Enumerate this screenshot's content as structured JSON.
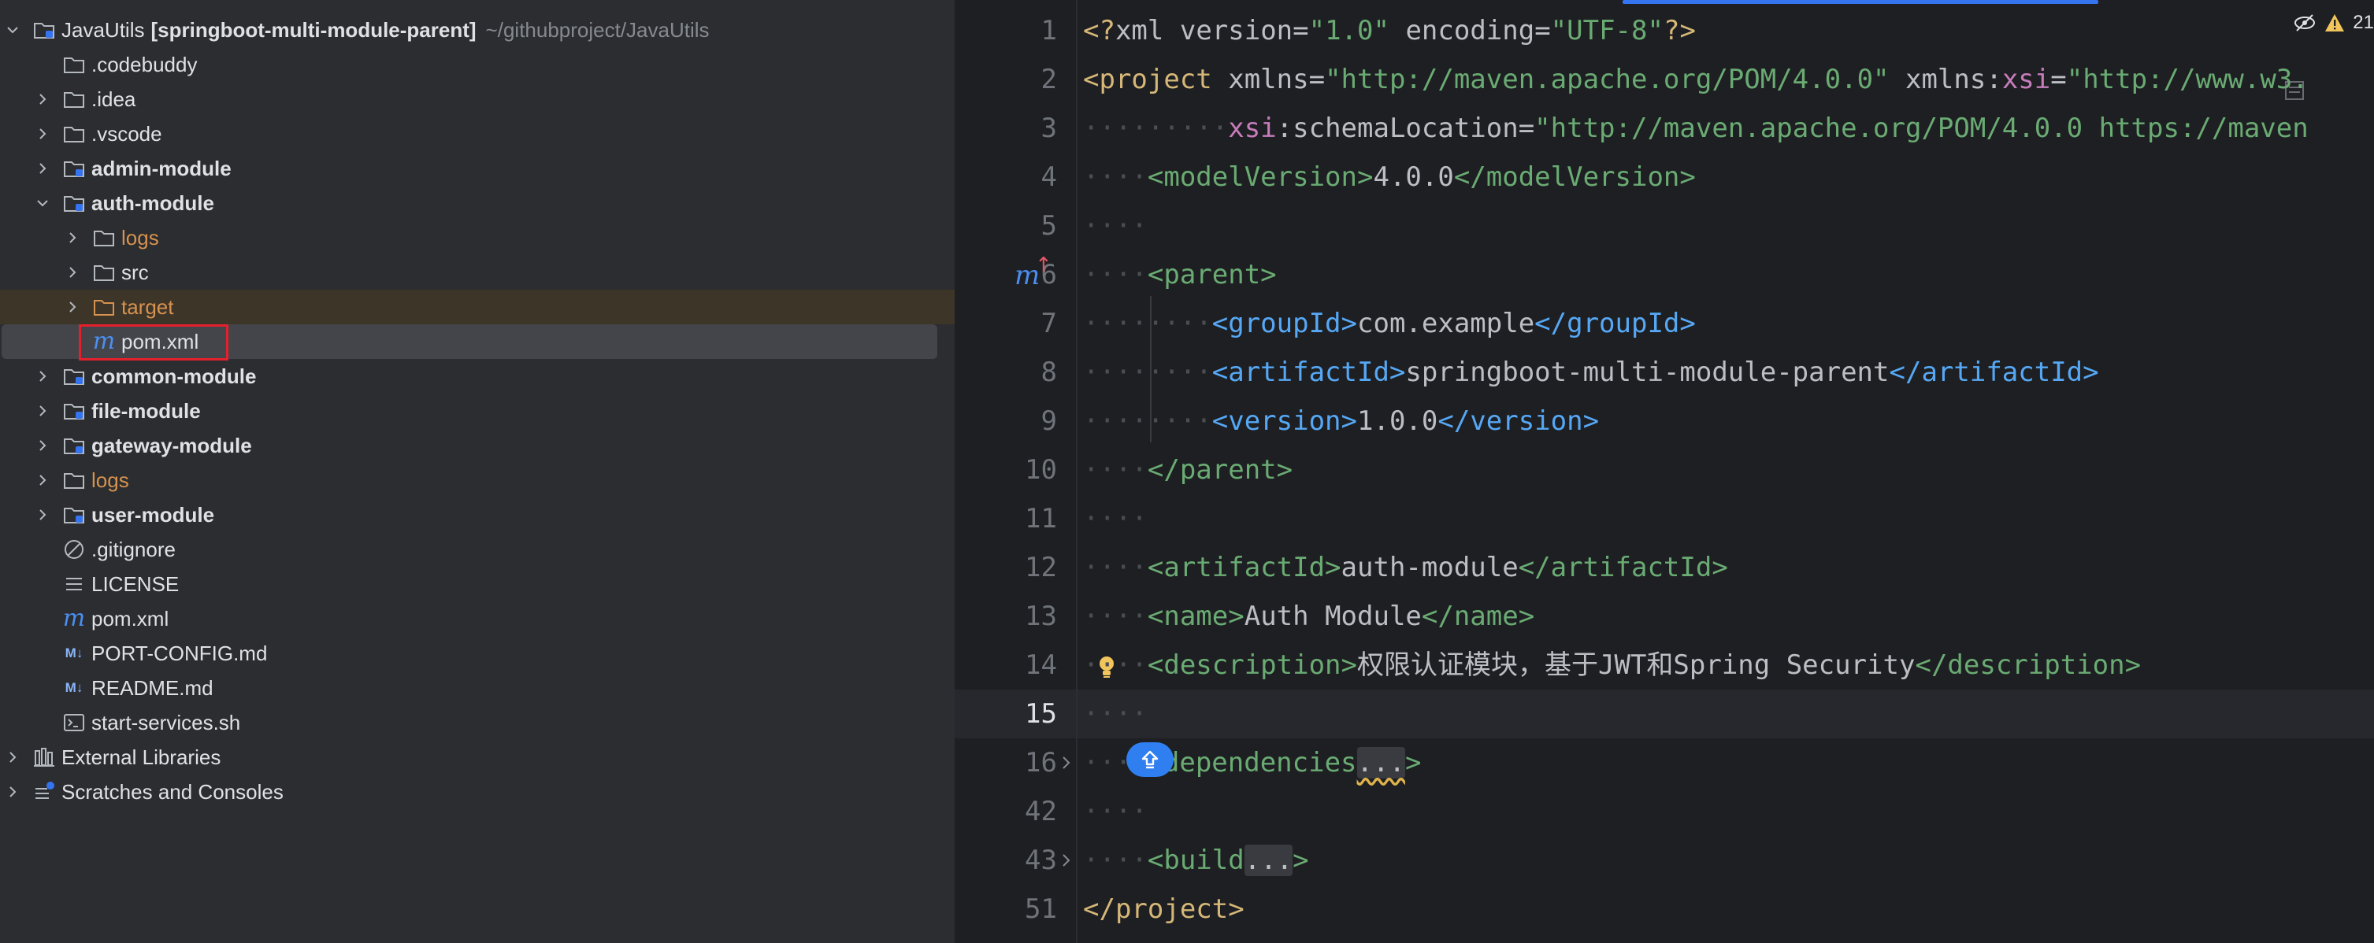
{
  "project_tree": {
    "root": {
      "name": "JavaUtils",
      "module": "[springboot-multi-module-parent]",
      "path": "~/githubproject/JavaUtils"
    },
    "items": [
      {
        "label": ".codebuddy"
      },
      {
        "label": ".idea"
      },
      {
        "label": ".vscode"
      },
      {
        "label": "admin-module"
      },
      {
        "label": "auth-module"
      },
      {
        "label": "logs"
      },
      {
        "label": "src"
      },
      {
        "label": "target"
      },
      {
        "label": "pom.xml"
      },
      {
        "label": "common-module"
      },
      {
        "label": "file-module"
      },
      {
        "label": "gateway-module"
      },
      {
        "label": "logs"
      },
      {
        "label": "user-module"
      },
      {
        "label": ".gitignore"
      },
      {
        "label": "LICENSE"
      },
      {
        "label": "pom.xml"
      },
      {
        "label": "PORT-CONFIG.md"
      },
      {
        "label": "README.md"
      },
      {
        "label": "start-services.sh"
      },
      {
        "label": "External Libraries"
      },
      {
        "label": "Scratches and Consoles"
      }
    ],
    "md_icon_text": "M↓"
  },
  "editor": {
    "inspection_count": "21",
    "line_numbers": [
      "1",
      "2",
      "3",
      "4",
      "5",
      "6",
      "7",
      "8",
      "9",
      "10",
      "11",
      "12",
      "13",
      "14",
      "15",
      "16",
      "42",
      "43",
      "51"
    ],
    "code": {
      "xml_decl_open": "<?",
      "xml_word": "xml",
      "version_attr": " version=",
      "version_val": "\"1.0\"",
      "encoding_attr": " encoding=",
      "encoding_val": "\"UTF-8\"",
      "xml_decl_close": "?>",
      "project_open": "<project",
      "xmlns_attr": " xmlns=",
      "xmlns_val": "\"http://maven.apache.org/POM/4.0.0\"",
      "xmlns_xsi_prefix": " xmlns:",
      "xsi_word": "xsi",
      "eq": "=",
      "xsi_val": "\"http://www.w3.",
      "dots9": "·········",
      "schema_xsi": "xsi",
      "schema_attr": ":schemaLocation=",
      "schema_val": "\"http://maven.apache.org/POM/4.0.0 https://maven",
      "dots4": "····",
      "dots8": "········",
      "model_open": "<modelVersion>",
      "model_val": "4.0.0",
      "model_close": "</modelVersion>",
      "parent_open": "<parent>",
      "groupid_open": "<groupId>",
      "groupid_val": "com.example",
      "groupid_close": "</groupId>",
      "artifact_open": "<artifactId>",
      "artifact_val": "springboot-multi-module-parent",
      "artifact_close": "</artifactId>",
      "version_open": "<version>",
      "version_val2": "1.0.0",
      "version_close": "</version>",
      "parent_close": "</parent>",
      "artifact2_val": "auth-module",
      "name_open": "<name>",
      "name_val": "Auth Module",
      "name_close": "</name>",
      "desc_open": "<description>",
      "desc_val": "权限认证模块，基于JWT和Spring Security",
      "desc_close": "</description>",
      "dep_tail": "dependencies",
      "fold_dots": "...",
      "gt": ">",
      "build_open": "<build",
      "project_close": "</project>"
    }
  },
  "colors": {
    "accent_blue": "#3574f0",
    "highlight_red": "#e5202d",
    "maven_blue": "#4b8ef0",
    "excluded_orange": "#d6924f"
  }
}
